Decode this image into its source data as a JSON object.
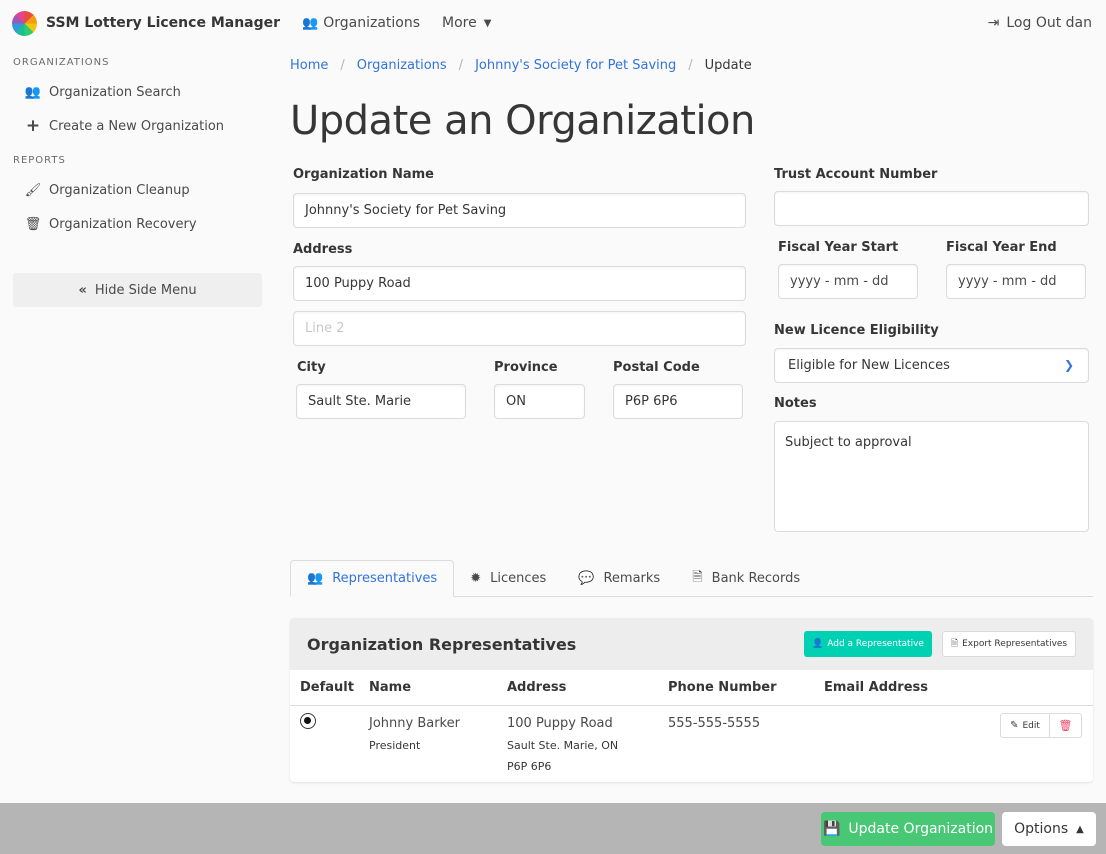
{
  "navbar": {
    "brand": "SSM Lottery Licence Manager",
    "organizations": "Organizations",
    "more": "More",
    "logout": "Log Out dan"
  },
  "sidebar": {
    "section_organizations": "Organizations",
    "organization_search": "Organization Search",
    "create_organization": "Create a New Organization",
    "section_reports": "Reports",
    "organization_cleanup": "Organization Cleanup",
    "organization_recovery": "Organization Recovery",
    "hide_menu": "Hide Side Menu"
  },
  "breadcrumb": [
    "Home",
    "Organizations",
    "Johnny's Society for Pet Saving",
    "Update"
  ],
  "page_title": "Update an Organization",
  "form": {
    "org_name_label": "Organization Name",
    "org_name_value": "Johnny's Society for Pet Saving",
    "address_label": "Address",
    "address1_value": "100 Puppy Road",
    "address2_placeholder": "Line 2",
    "city_label": "City",
    "city_value": "Sault Ste. Marie",
    "province_label": "Province",
    "province_value": "ON",
    "postal_label": "Postal Code",
    "postal_value": "P6P 6P6",
    "trust_label": "Trust Account Number",
    "trust_value": "",
    "fy_start_label": "Fiscal Year Start",
    "fy_start_placeholder": "yyyy - mm - dd",
    "fy_end_label": "Fiscal Year End",
    "fy_end_placeholder": "yyyy - mm - dd",
    "eligibility_label": "New Licence Eligibility",
    "eligibility_value": "Eligible for New Licences",
    "notes_label": "Notes",
    "notes_value": "Subject to approval"
  },
  "tabs": [
    "Representatives",
    "Licences",
    "Remarks",
    "Bank Records"
  ],
  "representatives": {
    "title": "Organization Representatives",
    "add_button": "Add a Representative",
    "export_button": "Export Representatives",
    "columns": [
      "Default",
      "Name",
      "Address",
      "Phone Number",
      "Email Address"
    ],
    "rows": [
      {
        "name": "Johnny Barker",
        "title": "President",
        "address1": "100 Puppy Road",
        "address2": "Sault Ste. Marie, ON",
        "address3": "P6P 6P6",
        "phone": "555-555-5555",
        "email": "",
        "edit_label": "Edit"
      }
    ]
  },
  "footer": {
    "update_button": "Update Organization",
    "options_button": "Options"
  },
  "colors": {
    "link": "#3273dc",
    "primary_teal": "#00d1b2",
    "success_green": "#48c774",
    "danger_red": "#f14668"
  }
}
